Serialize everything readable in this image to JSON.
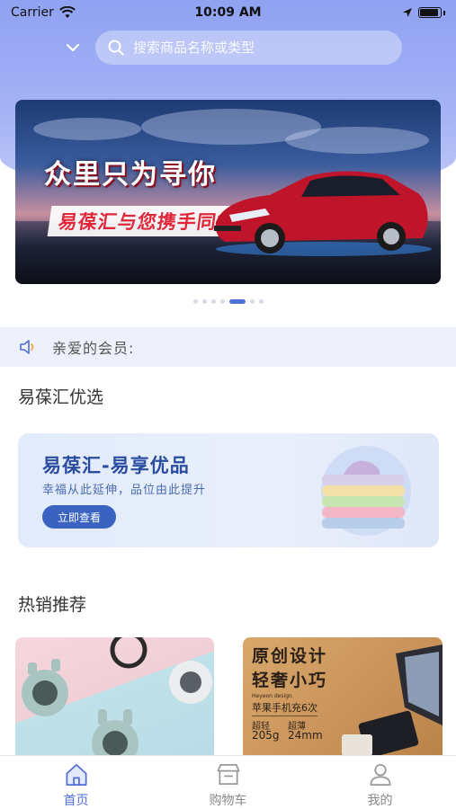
{
  "status_bar": {
    "carrier": "Carrier",
    "time": "10:09 AM"
  },
  "search": {
    "placeholder": "搜索商品名称或类型"
  },
  "banner": {
    "title": "众里只为寻你",
    "subtitle": "易葆汇与您携手同行",
    "total_slides": 7,
    "active_slide": 4
  },
  "notice": {
    "text": "亲爱的会员:"
  },
  "featured": {
    "section_title": "易葆汇优选",
    "promo_title": "易葆汇-易享优品",
    "promo_subtitle": "幸福从此延伸，品位由此提升",
    "promo_button": "立即查看"
  },
  "hot": {
    "section_title": "热销推荐",
    "right_card": {
      "line1": "原创设计",
      "line2": "轻奢小巧",
      "small": "Heyeon design",
      "tag": "苹果手机充6次",
      "spec1_label": "超轻",
      "spec1_value": "205g",
      "spec2_label": "超薄",
      "spec2_value": "24mm"
    }
  },
  "tabbar": {
    "items": [
      {
        "label": "首页"
      },
      {
        "label": "购物车"
      },
      {
        "label": "我的"
      }
    ]
  },
  "colors": {
    "accent": "#4f6fd8",
    "header": "#8fa2f2",
    "promo_button": "#3a62c0"
  }
}
